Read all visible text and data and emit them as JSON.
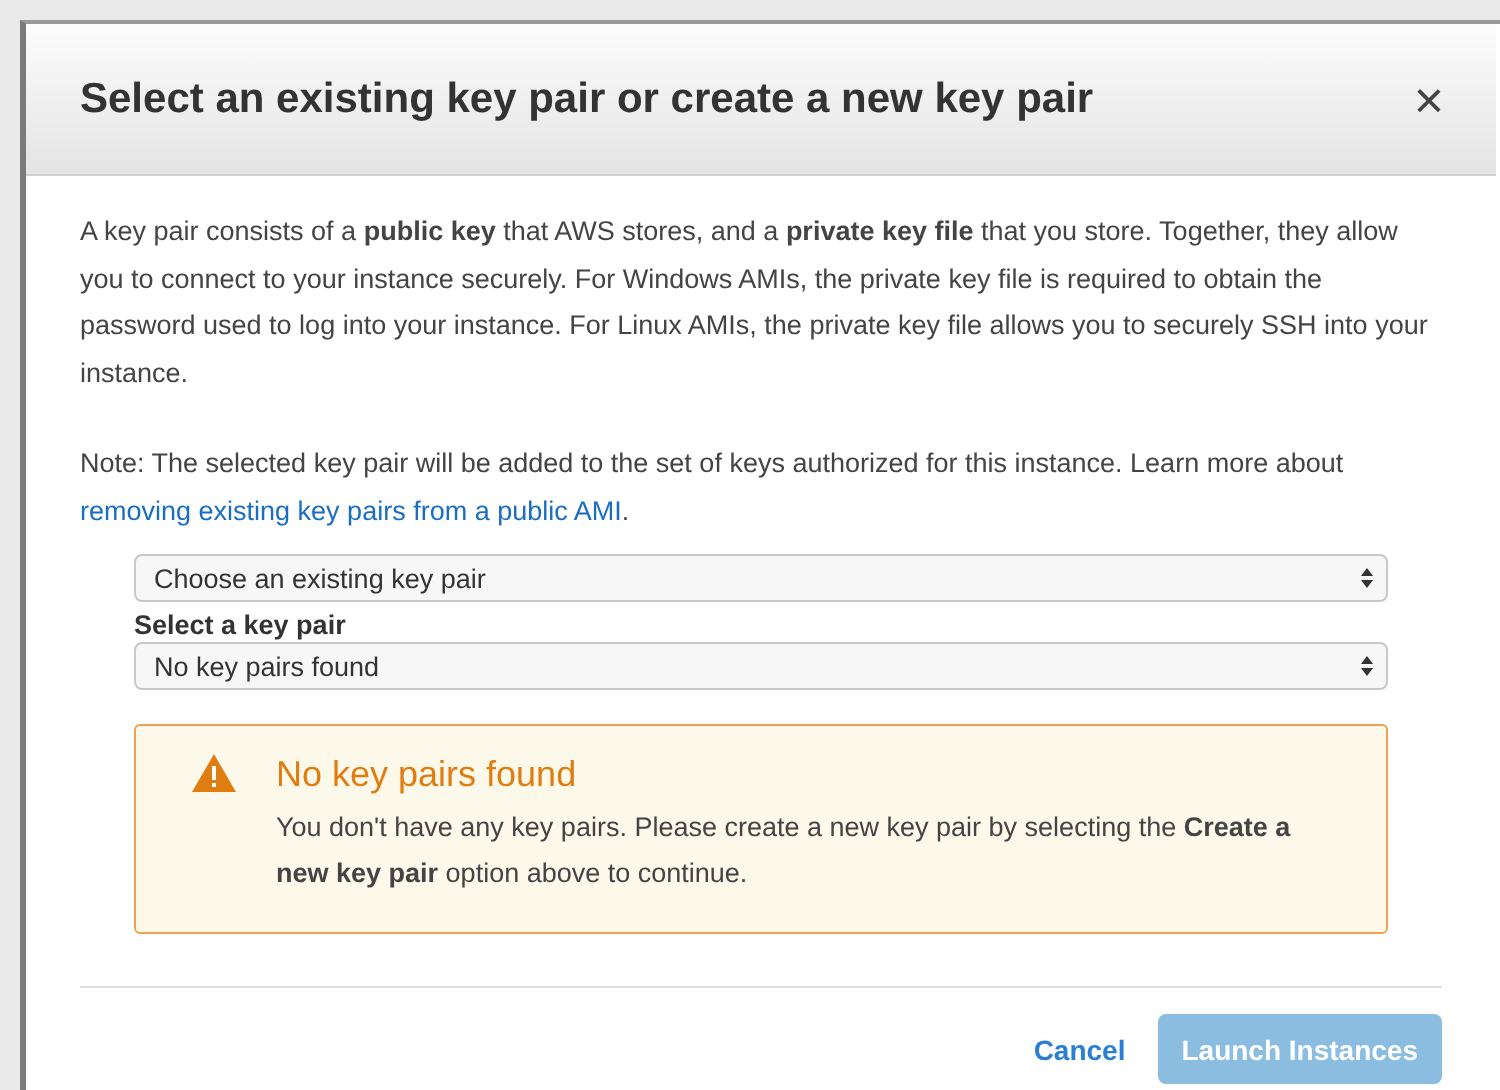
{
  "dialog": {
    "title": "Select an existing key pair or create a new key pair",
    "close": "×",
    "description": "A key pair consists of a **public key** that AWS stores, and a **private key file** that you store. Together, they allow you to connect to your instance securely. For Windows AMIs, the private key file is required to obtain the password used to log into your instance. For Linux AMIs, the private key file allows you to securely SSH into your instance.",
    "note": {
      "text": "Note: The selected key pair will be added to the set of keys authorized for this instance. Learn more about",
      "link": "removing existing key pairs from a public AMI",
      "suffix": "."
    },
    "mode_select": {
      "value": "Choose an existing key pair"
    },
    "key_select": {
      "label": "Select a key pair",
      "value": "No key pairs found"
    },
    "alert": {
      "kind": "warning",
      "title": "No key pairs found",
      "message": "You don't have any key pairs. Please create a new key pair by selecting the **Create a new key pair** option above to continue."
    },
    "buttons": [
      {
        "kind": "link",
        "label": "Cancel",
        "disabled": false
      },
      {
        "kind": "primary",
        "label": "Launch Instances",
        "disabled": true
      }
    ]
  }
}
